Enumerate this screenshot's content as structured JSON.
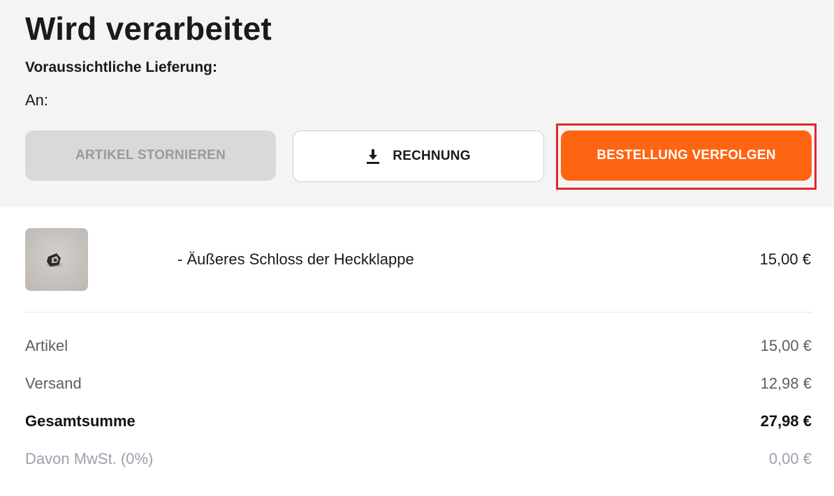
{
  "order": {
    "status_title": "Wird verarbeitet",
    "delivery_label": "Voraussichtliche Lieferung:",
    "recipient_label": "An:"
  },
  "actions": {
    "cancel_label": "ARTIKEL STORNIEREN",
    "invoice_label": "RECHNUNG",
    "invoice_icon": "download-icon",
    "track_label": "BESTELLUNG VERFOLGEN"
  },
  "item": {
    "name": "- Äußeres Schloss der Heckklappe",
    "price": "15,00 €"
  },
  "summary": {
    "articles_label": "Artikel",
    "articles_value": "15,00 €",
    "shipping_label": "Versand",
    "shipping_value": "12,98 €",
    "total_label": "Gesamtsumme",
    "total_value": "27,98 €",
    "tax_label": "Davon MwSt. (0%)",
    "tax_value": "0,00 €"
  },
  "colors": {
    "accent": "#ff6412",
    "highlight": "#e0262d",
    "disabled_bg": "#d9d9d9",
    "header_bg": "#f4f4f4"
  }
}
